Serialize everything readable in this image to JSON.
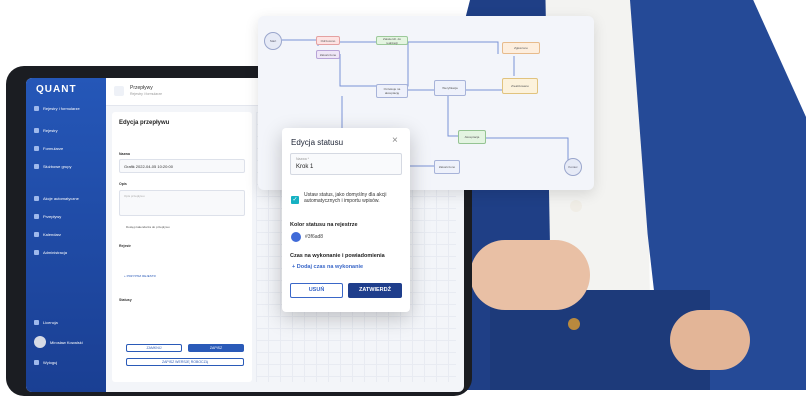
{
  "app": {
    "logo": "QUANT",
    "topbar_title": "Przepływy",
    "topbar_sub": "Rejestry i formularze"
  },
  "sidebar": {
    "items": [
      {
        "label": "Rejestry i formularze",
        "icon": "list-icon"
      },
      {
        "label": "Rejestry",
        "icon": "table-icon"
      },
      {
        "label": "Formularze",
        "icon": "form-icon"
      },
      {
        "label": "Służbowe grupy",
        "icon": "group-icon"
      },
      {
        "label": "Akcje automatyczne",
        "icon": "gear-icon"
      },
      {
        "label": "Przepływy",
        "icon": "flow-icon"
      },
      {
        "label": "Kalendarz",
        "icon": "calendar-icon"
      },
      {
        "label": "Administracja",
        "icon": "settings-icon"
      }
    ],
    "license": "Licencja",
    "user": "Mirosław Kowalski",
    "logout": "Wyloguj"
  },
  "editor": {
    "title": "Edycja przepływu",
    "name_label": "Nazwa",
    "name_value": "Grafik 2022-04-05 10:20:00",
    "desc_label": "Opis",
    "desc_placeholder": "Opis przepływu",
    "calendar_toggle": "Dostęp kalendarza do przepływu",
    "registers_label": "Rejestr",
    "add_register": "+ PRZYPISZ REJESTR",
    "statuses_label": "Statusy",
    "cancel_btn": "ZAMKNIJ",
    "save_btn": "ZAPISZ",
    "save_new_btn": "ZAPISZ WERSJĘ ROBOCZĄ"
  },
  "flow": {
    "nodes": [
      "Start",
      "Odrzucono",
      "Zatwierdz. do realizacji",
      "Zakończone",
      "Zgłoszono",
      "Oczekuje na akceptację",
      "Weryfikacja",
      "Zrealizowano",
      "Akceptacja",
      "Zakończono",
      "Koniec"
    ]
  },
  "modal": {
    "title": "Edycja statusu",
    "close": "×",
    "name_label": "Nazwa *",
    "name_value": "Krok 1",
    "default_checkbox": "Ustaw status, jako domyślny dla akcji automatycznych i importu wpisów.",
    "color_label": "Kolor statusu na rejestrze",
    "color_value": "#3f6ad8",
    "time_label": "Czas na wykonanie i powiadomienia",
    "add_time": "+ Dodaj czas na wykonanie",
    "cancel": "USUŃ",
    "confirm": "ZATWIERDŹ"
  },
  "colors": {
    "accent": "#3f6ad8",
    "sidebar": "#2557b8",
    "check": "#16b1c2"
  }
}
